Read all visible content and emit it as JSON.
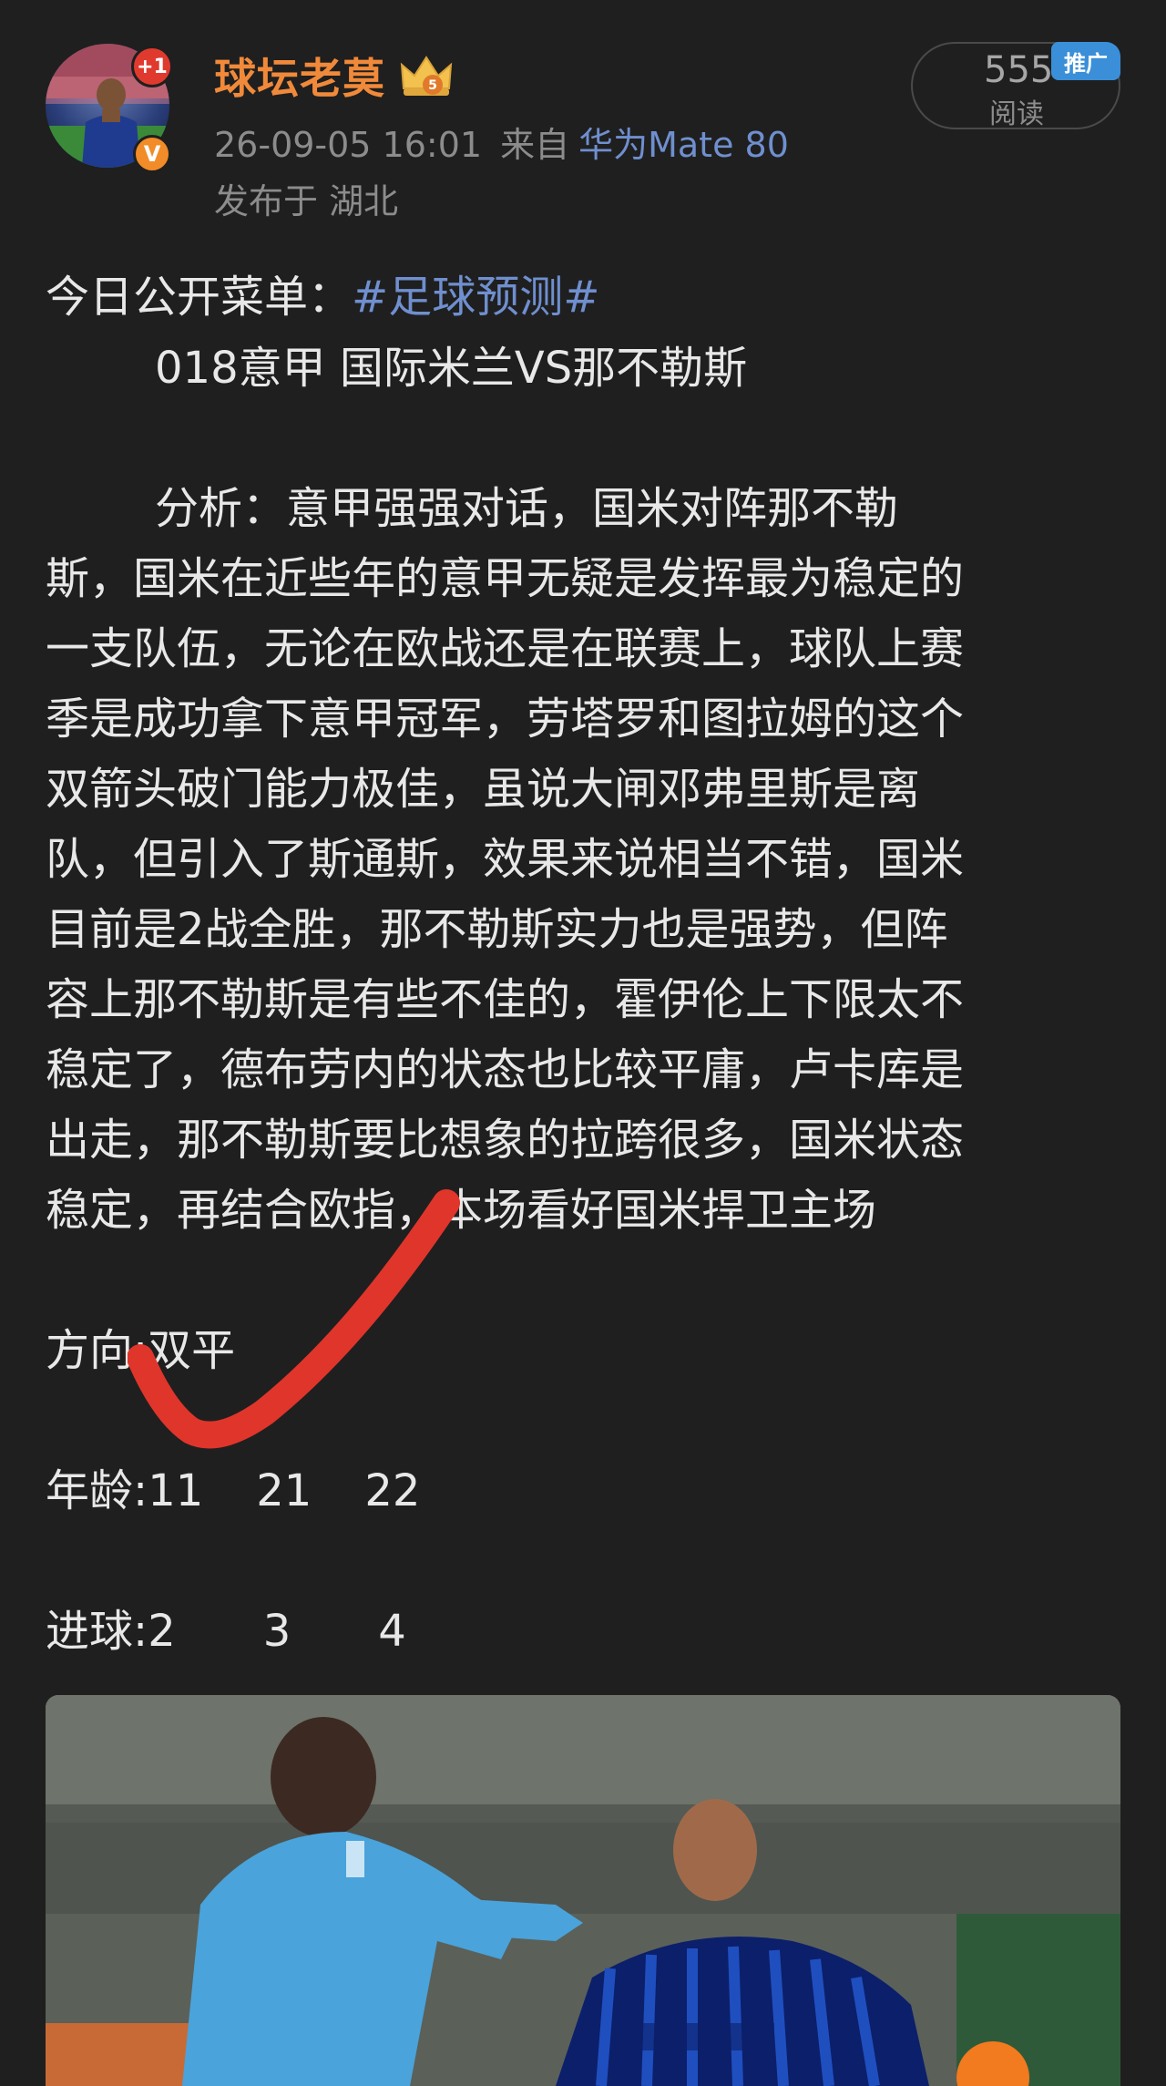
{
  "header": {
    "username": "球坛老莫",
    "plus_badge": "+1",
    "verified_badge": "V",
    "crown_level": "5",
    "timestamp": "26-09-05 16:01",
    "from_label": "来自",
    "device": "华为Mate 80",
    "location": "发布于 湖北",
    "read_count": "555",
    "read_label": "阅读",
    "promo_tag": "推广"
  },
  "post": {
    "menu_prefix": "今日公开菜单：",
    "hashtag": "#足球预测#",
    "match_line": "018意甲 国际米兰VS那不勒斯",
    "analysis_lines": [
      "分析：意甲强强对话，国米对阵那不勒",
      "斯，国米在近些年的意甲无疑是发挥最为稳定的",
      "一支队伍，无论在欧战还是在联赛上，球队上赛",
      "季是成功拿下意甲冠军，劳塔罗和图拉姆的这个",
      "双箭头破门能力极佳，虽说大闸邓弗里斯是离",
      "队，但引入了斯通斯，效果来说相当不错，国米",
      "目前是2战全胜，那不勒斯实力也是强势，但阵",
      "容上那不勒斯是有些不佳的，霍伊伦上下限太不",
      "稳定了，德布劳内的状态也比较平庸，卢卡库是",
      "出走，那不勒斯要比想象的拉跨很多，国米状态",
      "稳定，再结合欧指，本场看好国米捍卫主场"
    ],
    "direction": "方向:双平",
    "age_label": "年龄:",
    "age_values": [
      "11",
      "21",
      "22"
    ],
    "goals_label": "进球:",
    "goals_values": [
      "2",
      "3",
      "4"
    ]
  },
  "colors": {
    "background": "#1f1f1f",
    "username": "#f08a3a",
    "link": "#6f8fcf",
    "check_mark": "#e0352b",
    "promo": "#3a8fd8"
  }
}
